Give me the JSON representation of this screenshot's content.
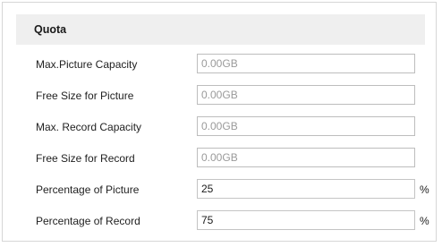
{
  "section": {
    "title": "Quota"
  },
  "fields": [
    {
      "label": "Max.Picture Capacity",
      "value": "0.00GB",
      "editable": false
    },
    {
      "label": "Free Size for Picture",
      "value": "0.00GB",
      "editable": false
    },
    {
      "label": "Max. Record Capacity",
      "value": "0.00GB",
      "editable": false
    },
    {
      "label": "Free Size for Record",
      "value": "0.00GB",
      "editable": false
    },
    {
      "label": "Percentage of Picture",
      "value": "25",
      "unit": "%",
      "editable": true
    },
    {
      "label": "Percentage of Record",
      "value": "75",
      "unit": "%",
      "editable": true
    }
  ],
  "colors": {
    "header_bg": "#efefef",
    "border": "#d6d6d6",
    "disabled_text": "#9a9a9a"
  }
}
